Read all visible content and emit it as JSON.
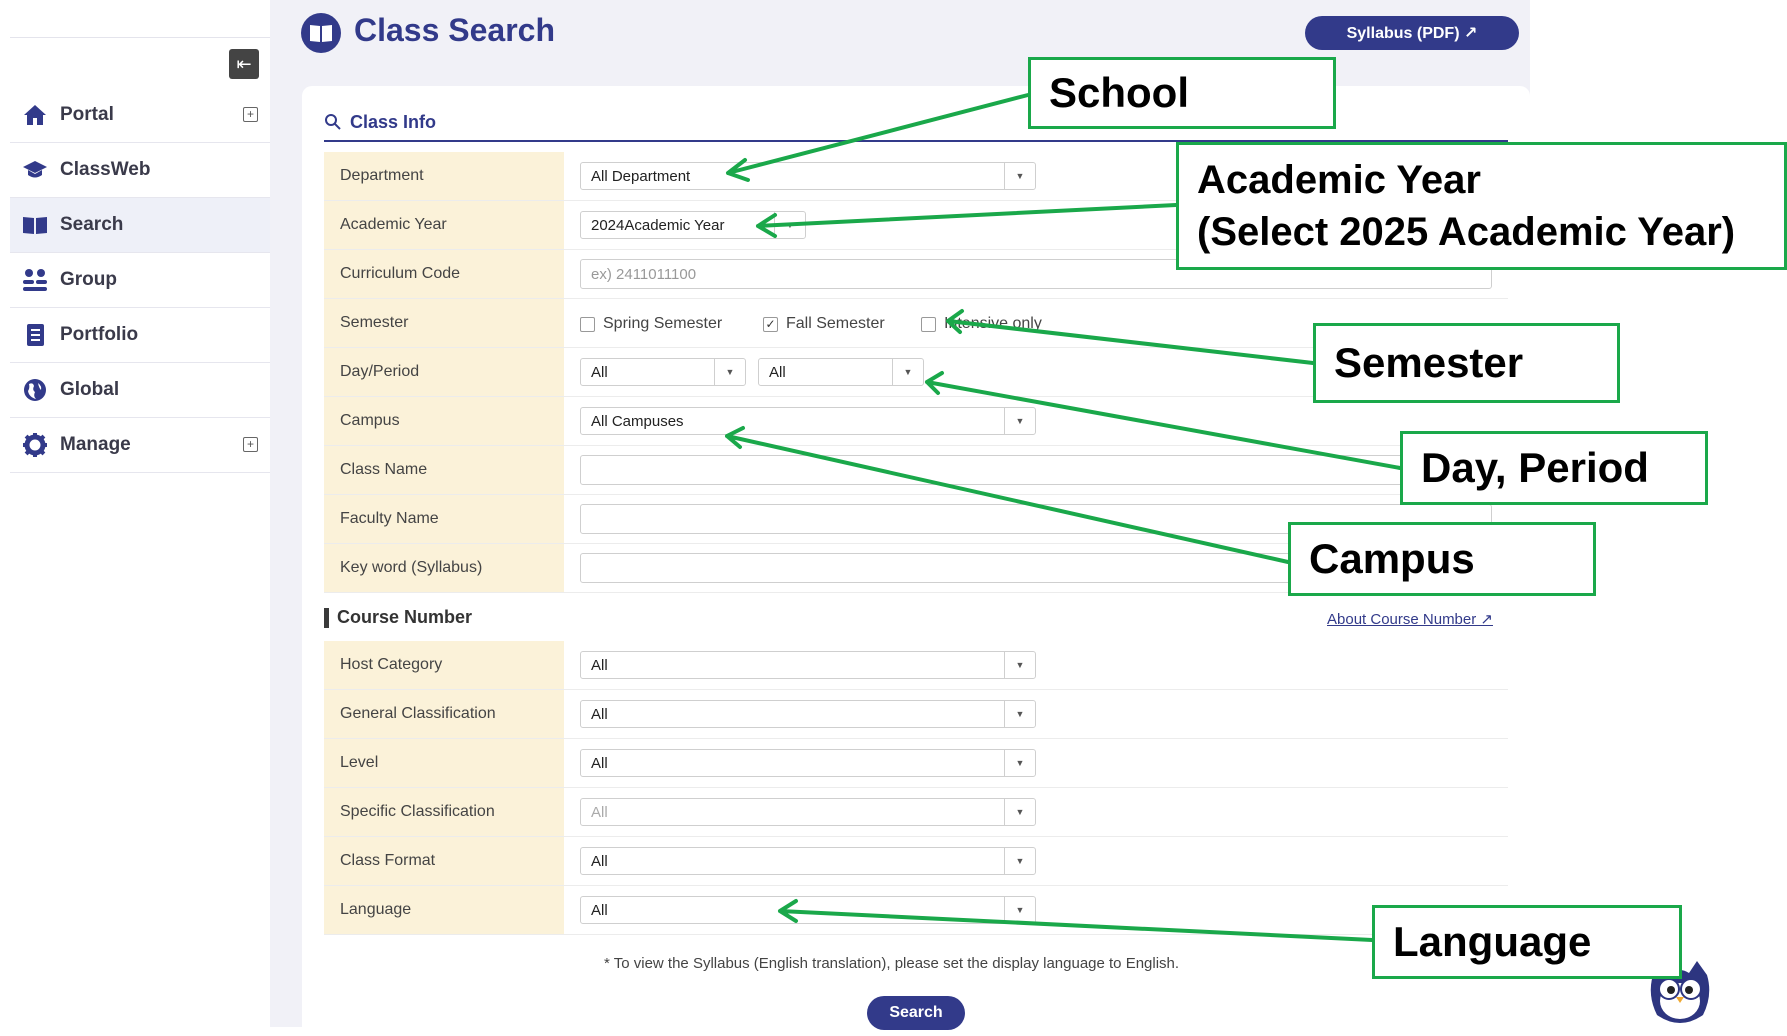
{
  "sidebar": {
    "collapse_glyph": "⇤",
    "items": [
      {
        "label": "Portal",
        "icon": "home-icon",
        "expandable": true
      },
      {
        "label": "ClassWeb",
        "icon": "graduation-cap-icon",
        "expandable": false
      },
      {
        "label": "Search",
        "icon": "open-book-icon",
        "expandable": false,
        "active": true
      },
      {
        "label": "Group",
        "icon": "group-icon",
        "expandable": false
      },
      {
        "label": "Portfolio",
        "icon": "notebook-icon",
        "expandable": false
      },
      {
        "label": "Global",
        "icon": "globe-icon",
        "expandable": false
      },
      {
        "label": "Manage",
        "icon": "gear-icon",
        "expandable": true
      }
    ]
  },
  "header": {
    "title": "Class Search",
    "syllabus_button": "Syllabus (PDF) ↗"
  },
  "class_info": {
    "section_label": "Class Info",
    "department": {
      "label": "Department",
      "value": "All Department"
    },
    "academic_year": {
      "label": "Academic Year",
      "value": "2024Academic Year"
    },
    "curriculum_code": {
      "label": "Curriculum Code",
      "placeholder": "ex) 2411011100"
    },
    "semester": {
      "label": "Semester",
      "options": [
        {
          "label": "Spring Semester",
          "checked": false
        },
        {
          "label": "Fall Semester",
          "checked": true
        },
        {
          "label": "Intensive only",
          "checked": false
        }
      ]
    },
    "day_period": {
      "label": "Day/Period",
      "day": "All",
      "period": "All"
    },
    "campus": {
      "label": "Campus",
      "value": "All Campuses"
    },
    "class_name": {
      "label": "Class Name",
      "value": ""
    },
    "faculty_name": {
      "label": "Faculty Name",
      "value": ""
    },
    "keyword": {
      "label": "Key word (Syllabus)",
      "value": ""
    }
  },
  "course_number": {
    "section_label": "Course Number",
    "about_link": "About Course Number ↗",
    "host_category": {
      "label": "Host Category",
      "value": "All"
    },
    "general_classification": {
      "label": "General Classification",
      "value": "All"
    },
    "level": {
      "label": "Level",
      "value": "All"
    },
    "specific_classification": {
      "label": "Specific Classification",
      "value": "All"
    },
    "class_format": {
      "label": "Class Format",
      "value": "All"
    },
    "language": {
      "label": "Language",
      "value": "All"
    }
  },
  "footer": {
    "note": "* To view the Syllabus (English translation), please set the display language to English.",
    "search_button": "Search"
  },
  "annotations": {
    "school": "School",
    "academic_year_line1": "Academic Year",
    "academic_year_line2": "(Select 2025 Academic Year)",
    "semester": "Semester",
    "day_period": "Day, Period",
    "campus": "Campus",
    "language": "Language"
  },
  "colors": {
    "brand": "#323a8a",
    "label_bg": "#fbf2d9",
    "annotation_green": "#1aa84a"
  }
}
